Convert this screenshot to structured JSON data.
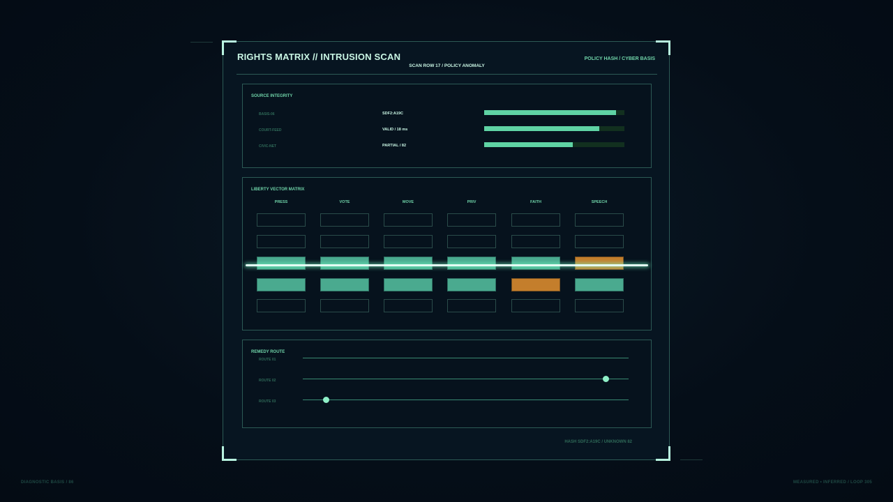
{
  "header": {
    "title": "RIGHTS MATRIX // INTRUSION SCAN",
    "subtitle": "SCAN ROW 17 / POLICY ANOMALY",
    "policy": "POLICY HASH / CYBER BASIS"
  },
  "source_integrity": {
    "title": "SOURCE INTEGRITY",
    "rows": [
      {
        "label": "BASIS-06",
        "value": "SDF2:A19C",
        "level": 0.94
      },
      {
        "label": "COURT-FEED",
        "value": "VALID / 18 ms",
        "level": 0.82
      },
      {
        "label": "CIVIC-NET",
        "value": "PARTIAL / 82",
        "level": 0.63
      }
    ]
  },
  "matrix": {
    "title": "LIBERTY VECTOR MATRIX",
    "columns": [
      "PRESS",
      "VOTE",
      "MOVE",
      "PRIV",
      "FAITH",
      "SPEECH"
    ],
    "rows": [
      [
        "empty",
        "empty",
        "empty",
        "empty",
        "empty",
        "empty"
      ],
      [
        "empty",
        "empty",
        "empty",
        "empty",
        "empty",
        "empty"
      ],
      [
        "ok",
        "ok",
        "ok",
        "ok",
        "ok",
        "warn"
      ],
      [
        "ok",
        "ok",
        "ok",
        "ok",
        "warn",
        "ok"
      ],
      [
        "empty",
        "empty",
        "empty",
        "empty",
        "empty",
        "empty"
      ]
    ],
    "scan_row": 3
  },
  "remedy": {
    "title": "REMEDY ROUTE",
    "routes": [
      {
        "label": "ROUTE 01",
        "value": null
      },
      {
        "label": "ROUTE 02",
        "value": 0.93
      },
      {
        "label": "ROUTE 03",
        "value": 0.07
      }
    ]
  },
  "hash": "HASH SDF2:A19C / UNKNOWN 82",
  "footer": {
    "left": "DIAGNOSTIC BASIS / 86",
    "right": "MEASURED • INFERRED / LOOP 305"
  },
  "colors": {
    "accent": "#6fd3a8",
    "ok": "#4aaa8f",
    "warn": "#c47e2c",
    "background": "#050e18"
  }
}
